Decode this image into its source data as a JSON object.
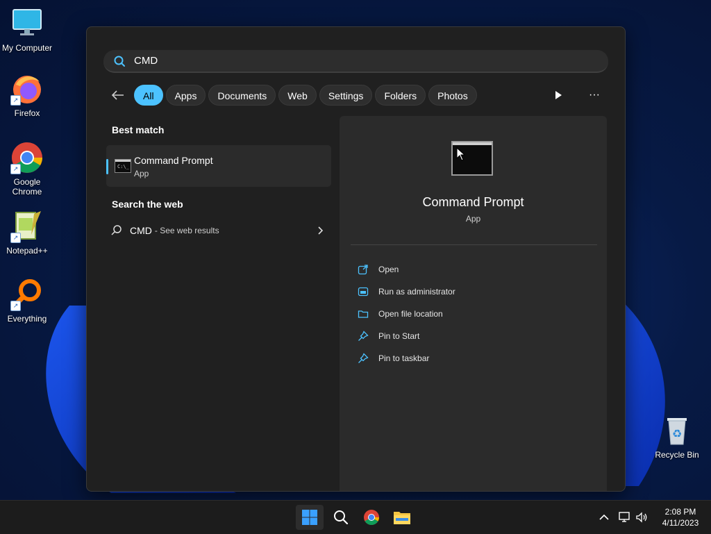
{
  "desktop": {
    "icons": [
      {
        "label": "My Computer"
      },
      {
        "label": "Firefox"
      },
      {
        "label": "Google Chrome"
      },
      {
        "label": "Notepad++"
      },
      {
        "label": "Everything"
      },
      {
        "label": "Recycle Bin"
      }
    ]
  },
  "search": {
    "query": "CMD",
    "filters": [
      "All",
      "Apps",
      "Documents",
      "Web",
      "Settings",
      "Folders",
      "Photos"
    ],
    "active_filter": "All"
  },
  "results": {
    "best_match_title": "Best match",
    "best_match": {
      "name": "Command Prompt",
      "type": "App"
    },
    "web_title": "Search the web",
    "web": {
      "query": "CMD",
      "hint": "- See web results"
    }
  },
  "details": {
    "name": "Command Prompt",
    "type": "App",
    "actions": [
      {
        "label": "Open",
        "icon": "open-icon"
      },
      {
        "label": "Run as administrator",
        "icon": "admin-icon"
      },
      {
        "label": "Open file location",
        "icon": "folder-icon"
      },
      {
        "label": "Pin to Start",
        "icon": "pin-icon"
      },
      {
        "label": "Pin to taskbar",
        "icon": "pin-icon"
      }
    ]
  },
  "taskbar": {
    "time": "2:08 PM",
    "date": "4/11/2023"
  },
  "colors": {
    "accent": "#4cc2ff",
    "panel": "#202020"
  }
}
